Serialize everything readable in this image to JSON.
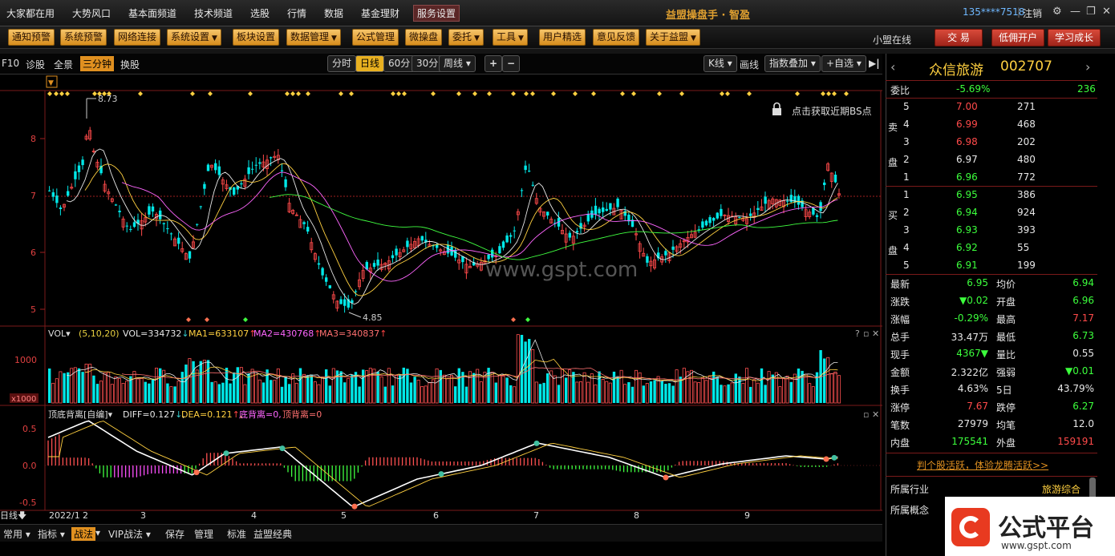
{
  "menu": {
    "items": [
      "大家都在用",
      "大势风口",
      "基本面频道",
      "技术频道",
      "选股",
      "行情",
      "数据",
      "基金理财",
      "服务设置"
    ],
    "app_title": "益盟操盘手 · 智盈",
    "account": "135****7518",
    "logout": "注销"
  },
  "toolbar": {
    "buttons": [
      "通知预警",
      "系统预警",
      "网络连接",
      "系统设置",
      "板块设置",
      "数据管理",
      "公式管理",
      "微操盘",
      "委托",
      "工具",
      "用户精选",
      "意见反馈",
      "关于益盟"
    ],
    "alliance": "小盟在线",
    "trade": "交 易",
    "open_account": "低佣开户",
    "learn": "学习成长"
  },
  "chart_toolbar": {
    "left": [
      "F10",
      "诊股",
      "全景",
      "三分钟",
      "换股"
    ],
    "periods": [
      "分时",
      "日线",
      "60分",
      "30分",
      "周线"
    ],
    "plus": "+",
    "minus": "−",
    "kline": "K线",
    "draw": "画线",
    "index_overlay": "指数叠加",
    "watch": "+自选"
  },
  "chart": {
    "watermark": "www.gspt.com",
    "bs_hint": "点击获取近期BS点",
    "high_label": "8.73",
    "low_label": "4.85",
    "y_ticks": [
      "8",
      "7",
      "6",
      "5"
    ],
    "x_ticks": [
      "2022/1",
      "2",
      "3",
      "4",
      "5",
      "6",
      "7",
      "8",
      "9"
    ],
    "period_label": "日线"
  },
  "vol": {
    "label": "VOL",
    "params": "(5,10,20)",
    "vol": "VOL=334732",
    "ma1": "MA1=633107",
    "ma2": "MA2=430768",
    "ma3": "MA3=340837",
    "y_tick": "1000",
    "unit": "x1000"
  },
  "macd": {
    "label": "顶底背离[自编]",
    "diff": "DIFF=0.127",
    "dea": "DEA=0.121",
    "bottom": "底背离=0",
    "top": "顶背离=0",
    "y_ticks": [
      "0.5",
      "0.0",
      "-0.5"
    ]
  },
  "stock": {
    "name": "众信旅游",
    "code": "002707"
  },
  "quote": {
    "weibi_label": "委比",
    "weibi": "-5.69%",
    "weibi_n": "236",
    "sell_label": [
      "卖",
      "盘"
    ],
    "buy_label": [
      "买",
      "盘"
    ],
    "sell": [
      {
        "n": "5",
        "p": "7.00",
        "v": "271"
      },
      {
        "n": "4",
        "p": "6.99",
        "v": "468"
      },
      {
        "n": "3",
        "p": "6.98",
        "v": "202"
      },
      {
        "n": "2",
        "p": "6.97",
        "v": "480"
      },
      {
        "n": "1",
        "p": "6.96",
        "v": "772"
      }
    ],
    "buy": [
      {
        "n": "1",
        "p": "6.95",
        "v": "386"
      },
      {
        "n": "2",
        "p": "6.94",
        "v": "924"
      },
      {
        "n": "3",
        "p": "6.93",
        "v": "393"
      },
      {
        "n": "4",
        "p": "6.92",
        "v": "55"
      },
      {
        "n": "5",
        "p": "6.91",
        "v": "199"
      }
    ],
    "stats": [
      [
        "最新",
        "6.95",
        "均价",
        "6.94"
      ],
      [
        "涨跌",
        "▼0.02",
        "开盘",
        "6.96"
      ],
      [
        "涨幅",
        "-0.29%",
        "最高",
        "7.17"
      ],
      [
        "总手",
        "33.47万",
        "最低",
        "6.73"
      ],
      [
        "现手",
        "4367▼",
        "量比",
        "0.55"
      ],
      [
        "金额",
        "2.322亿",
        "强弱",
        "▼0.01"
      ],
      [
        "换手",
        "4.63%",
        "5日",
        "43.79%"
      ],
      [
        "涨停",
        "7.67",
        "跌停",
        "6.27"
      ],
      [
        "笔数",
        "27979",
        "均笔",
        "12.0"
      ],
      [
        "内盘",
        "175541",
        "外盘",
        "159191"
      ]
    ],
    "promo": "判个股活跃，体验龙腾活跃>>",
    "industry_label": "所属行业",
    "industry": "旅游综合",
    "concept_label": "所属概念"
  },
  "bottom": {
    "items": [
      "常用",
      "指标",
      "战法",
      "VIP战法",
      "保存",
      "管理",
      "标准",
      "益盟经典"
    ]
  },
  "logo": {
    "text": "公式平台",
    "url": "www.gspt.com"
  },
  "colors": {
    "up": "#ff4a4a",
    "down": "#00e0e0",
    "accent": "#e09020"
  }
}
